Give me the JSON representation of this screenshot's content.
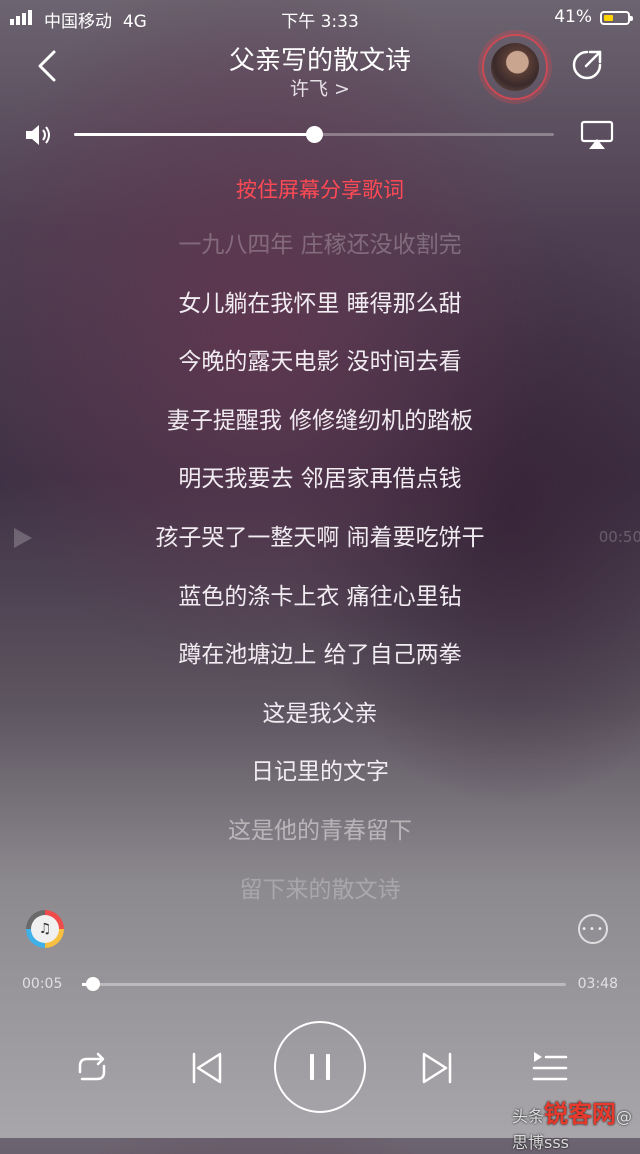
{
  "status_bar": {
    "carrier": "中国移动",
    "network": "4G",
    "time": "下午 3:33",
    "battery_pct": "41%",
    "battery_level": 0.41
  },
  "header": {
    "title": "父亲写的散文诗",
    "artist": "许飞 >"
  },
  "volume": {
    "level": 0.5
  },
  "hint": "按住屏幕分享歌词",
  "lyrics": [
    "一九八四年 庄稼还没收割完",
    "女儿躺在我怀里 睡得那么甜",
    "今晚的露天电影 没时间去看",
    "妻子提醒我 修修缝纫机的踏板",
    "明天我要去 邻居家再借点钱",
    "孩子哭了一整天啊 闹着要吃饼干",
    "蓝色的涤卡上衣 痛往心里钻",
    "蹲在池塘边上 给了自己两拳",
    "这是我父亲",
    "日记里的文字",
    "这是他的青春留下",
    "留下来的散文诗"
  ],
  "seek_preview": {
    "time": "00:50"
  },
  "music_badge": "♫",
  "playback": {
    "current_time": "00:05",
    "duration": "03:48",
    "progress": 0.022
  },
  "watermark": {
    "brand": "锐客网",
    "prefix": "头条",
    "suffix": "@思博sss"
  },
  "colors": {
    "accent": "#ff4a55",
    "watermark_brand": "#e83a2c"
  }
}
